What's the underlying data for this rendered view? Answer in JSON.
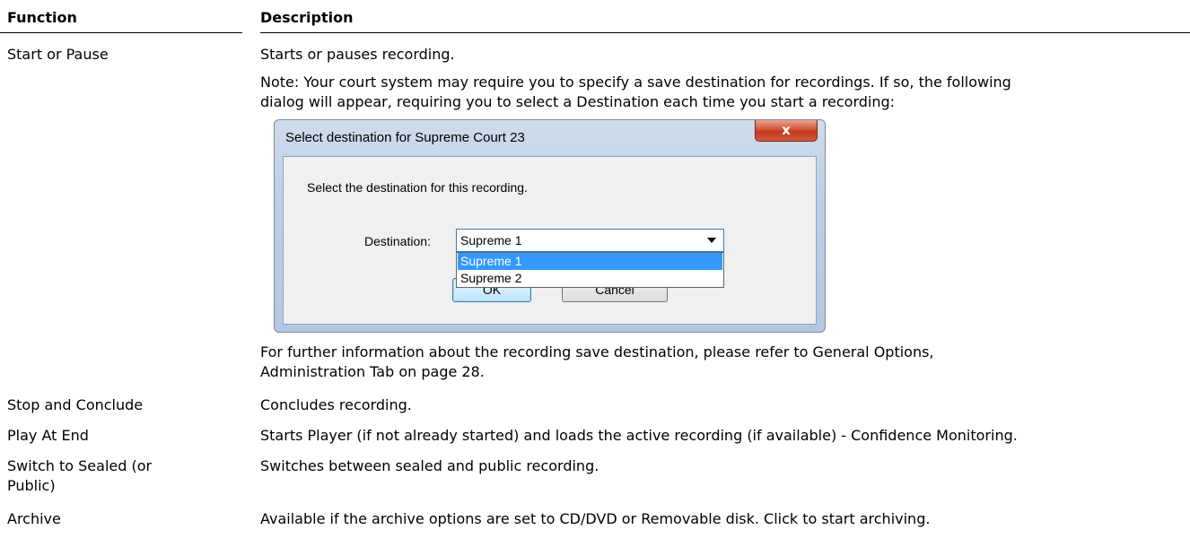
{
  "header": {
    "function": "Function",
    "description": "Description"
  },
  "rows": [
    {
      "function": "Start or Pause",
      "description": "Starts or pauses recording.",
      "note_line1": "Note: Your court system may require you to specify a save destination for recordings. If so, the following",
      "note_line2": "dialog will appear, requiring you to select a Destination each time you start a recording:",
      "after_line1": "For further information about the recording save destination, please refer to General Options,",
      "after_line2": "Administration Tab on page 28."
    },
    {
      "function": "Stop and Conclude",
      "description": "Concludes recording."
    },
    {
      "function": "Play At End",
      "description": "Starts Player (if not already started) and loads the active recording (if available) - Confidence Monitoring."
    },
    {
      "function_line1": "Switch to Sealed (or",
      "function_line2": "Public)",
      "description": "Switches between sealed and public recording."
    },
    {
      "function": "Archive",
      "description": "Available if the archive options are set to CD/DVD or Removable disk.  Click to start archiving."
    }
  ],
  "dialog": {
    "title": "Select destination for Supreme Court 23",
    "close_glyph": "x",
    "message": "Select the destination for this recording.",
    "destination_label": "Destination:",
    "selected_value": "Supreme 1",
    "options": [
      "Supreme 1",
      "Supreme 2"
    ],
    "ok_label": "OK",
    "cancel_label": "Cancel"
  }
}
